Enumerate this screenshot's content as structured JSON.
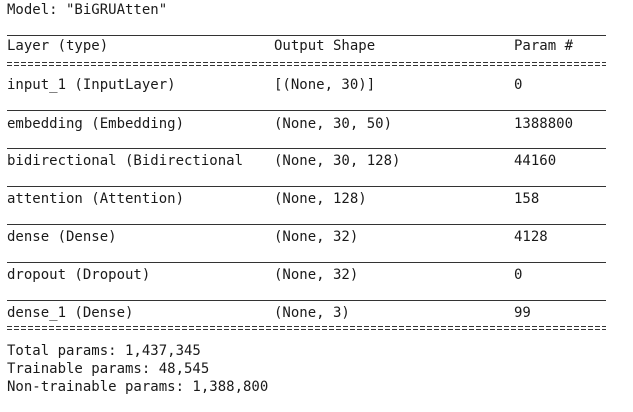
{
  "model_line": "Model: \"BiGRUAtten\"",
  "headers": {
    "layer": "Layer (type)",
    "output": "Output Shape",
    "param": "Param #"
  },
  "rows": [
    {
      "layer": "input_1 (InputLayer)",
      "output": "[(None, 30)]",
      "param": "0"
    },
    {
      "layer": "embedding (Embedding)",
      "output": "(None, 30, 50)",
      "param": "1388800"
    },
    {
      "layer": "bidirectional (Bidirectional",
      "output": "(None, 30, 128)",
      "param": "44160"
    },
    {
      "layer": "attention (Attention)",
      "output": "(None, 128)",
      "param": "158"
    },
    {
      "layer": "dense (Dense)",
      "output": "(None, 32)",
      "param": "4128"
    },
    {
      "layer": "dropout (Dropout)",
      "output": "(None, 32)",
      "param": "0"
    },
    {
      "layer": "dense_1 (Dense)",
      "output": "(None, 3)",
      "param": "99"
    }
  ],
  "totals": {
    "total": "Total params: 1,437,345",
    "trainable": "Trainable params: 48,545",
    "non_trainable": "Non-trainable params: 1,388,800"
  }
}
